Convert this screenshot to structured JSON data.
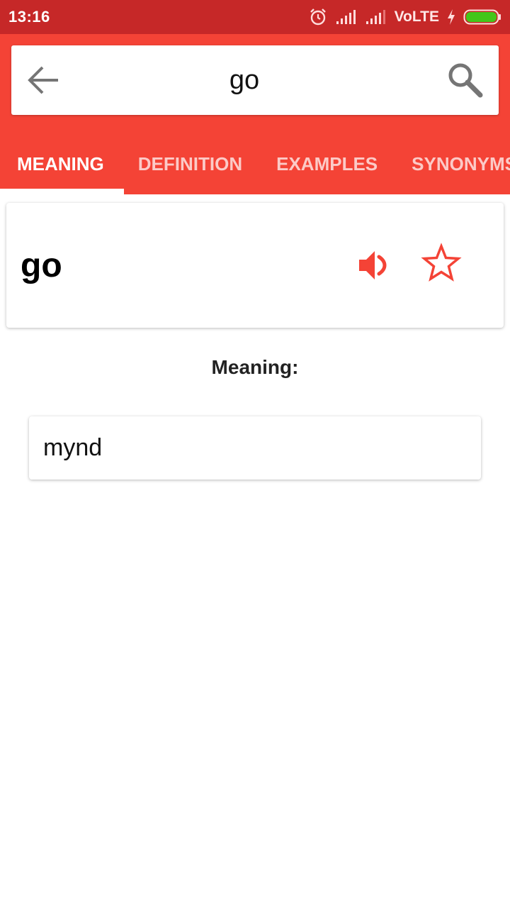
{
  "status_bar": {
    "time": "13:16",
    "network": "VoLTE",
    "icons": [
      "alarm-icon",
      "signal-icon",
      "signal-icon",
      "charging-icon",
      "battery-icon"
    ],
    "battery_color": "#43c61a"
  },
  "search": {
    "query": "go",
    "back_icon": "arrow-left-icon",
    "search_icon": "search-icon"
  },
  "tabs": [
    {
      "label": "MEANING",
      "active": true
    },
    {
      "label": "DEFINITION",
      "active": false
    },
    {
      "label": "EXAMPLES",
      "active": false
    },
    {
      "label": "SYNONYMS",
      "active": false
    }
  ],
  "word_card": {
    "word": "go",
    "speaker_icon": "speaker-icon",
    "favorite_icon": "star-outline-icon"
  },
  "meaning": {
    "label": "Meaning:",
    "value": "mynd"
  },
  "colors": {
    "primary": "#f44336",
    "status_bar": "#c62828",
    "accent": "#f44336"
  }
}
